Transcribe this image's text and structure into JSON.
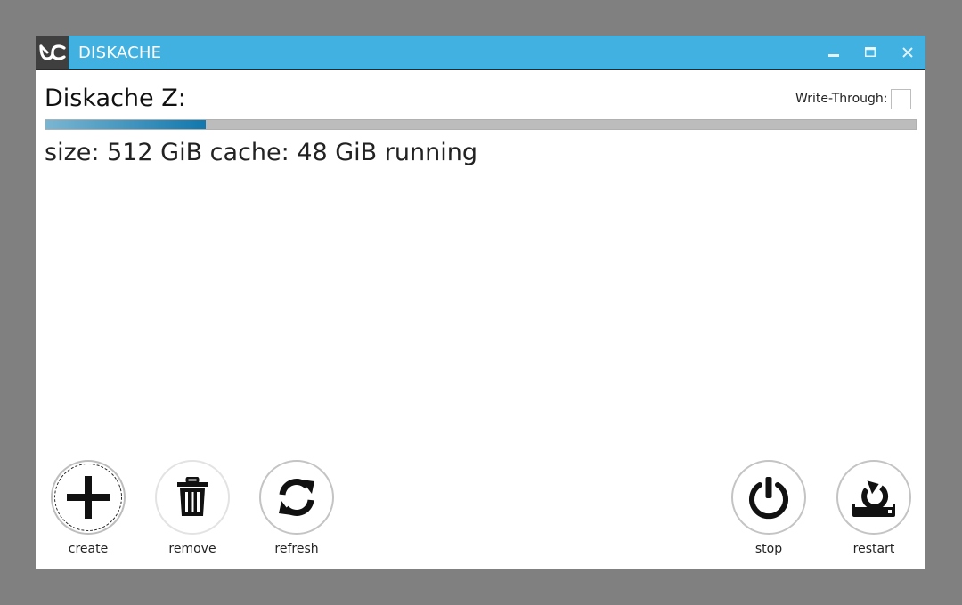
{
  "window": {
    "title": "DISKACHE"
  },
  "drive": {
    "title": "Diskache Z:",
    "write_through_label": "Write-Through:",
    "write_through_checked": false,
    "cache_fraction": 0.1845,
    "status_text": "size: 512 GiB cache: 48 GiB running"
  },
  "actions": {
    "create": "create",
    "remove": "remove",
    "refresh": "refresh",
    "stop": "stop",
    "restart": "restart"
  },
  "colors": {
    "titlebar": "#41b1e1",
    "progress_fill": "#1177ad",
    "progress_track": "#bcbcbc"
  },
  "icons": {
    "logo": "diskache-logo-icon",
    "minimize": "minimize-icon",
    "maximize": "maximize-icon",
    "close": "close-icon",
    "create": "plus-icon",
    "remove": "trash-icon",
    "refresh": "refresh-icon",
    "stop": "power-icon",
    "restart": "restart-icon"
  }
}
